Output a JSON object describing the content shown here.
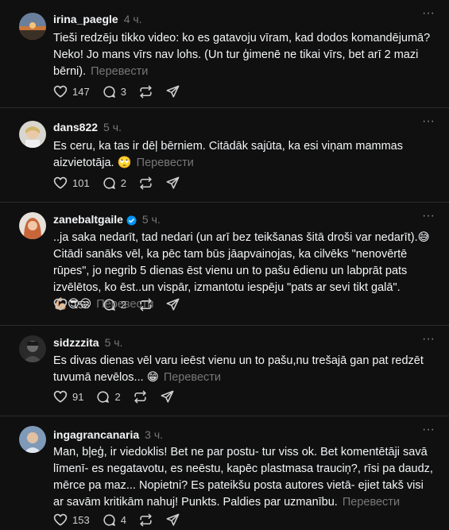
{
  "ui": {
    "translate_label": "Перевести",
    "more_glyph": "···",
    "colors": {
      "background": "#101010",
      "text": "#f3f5f7",
      "muted": "#777777",
      "divider": "#2b2b2b",
      "verified": "#0095f6"
    }
  },
  "posts": [
    {
      "username": "irina_paegle",
      "time": "4 ч.",
      "verified": false,
      "text": "Tieši redzēju tikko video: ko es gatavoju vīram, kad dodos komandējumā? Neko! Jo mans vīrs nav lohs. (Un tur ģimenē ne tikai vīrs, bet arī 2 mazi bērni).",
      "emoji": "",
      "likes": "147",
      "replies": "3",
      "reposts": ""
    },
    {
      "username": "dans822",
      "time": "5 ч.",
      "verified": false,
      "text": "Es ceru, ka tas ir dēļ bērniem. Citādāk sajūta, ka esi viņam mammas aizvietotāja.",
      "emoji": "🙄",
      "likes": "101",
      "replies": "2",
      "reposts": ""
    },
    {
      "username": "zanebaltgaile",
      "time": "5 ч.",
      "verified": true,
      "text_part1": "..ja saka nedarīt, tad nedari (un arī bez teikšanas šitā droši var nedarīt).",
      "emoji_mid": "😅",
      "text_part2": " Citādi sanāks vēl, ka pēc tam būs jāapvainojas, ka cilvēks \"nenovērtē rūpes\", jo negrib 5 dienas ēst vienu un to pašu ēdienu un labprāt pats izvēlētos, ko ēst..un vispār, izmantotu iespēju \"pats ar sevi tikt galā\".",
      "emoji": "💪🏼😎😛",
      "likes": "153",
      "replies": "2",
      "reposts": ""
    },
    {
      "username": "sidzzzita",
      "time": "5 ч.",
      "verified": false,
      "text": "Es divas dienas vēl varu ieēst vienu un to pašu,nu trešajā gan pat redzēt tuvumā nevēlos...",
      "emoji": "😁",
      "likes": "91",
      "replies": "2",
      "reposts": ""
    },
    {
      "username": "ingagrancanaria",
      "time": "3 ч.",
      "verified": false,
      "text": "Man, bļeģ, ir viedoklis! Bet ne par postu- tur viss ok. Bet komentētāji savā līmenī- es negatavotu, es neēstu, kapēc plastmasa trauciņ?, rīsi pa daudz, mērce pa maz... Nopietni? Es pateikšu posta autores vietā- ejiet takš visi ar savām kritikām nahuj! Punkts. Paldies par uzmanību.",
      "emoji": "",
      "likes": "153",
      "replies": "4",
      "reposts": ""
    }
  ]
}
